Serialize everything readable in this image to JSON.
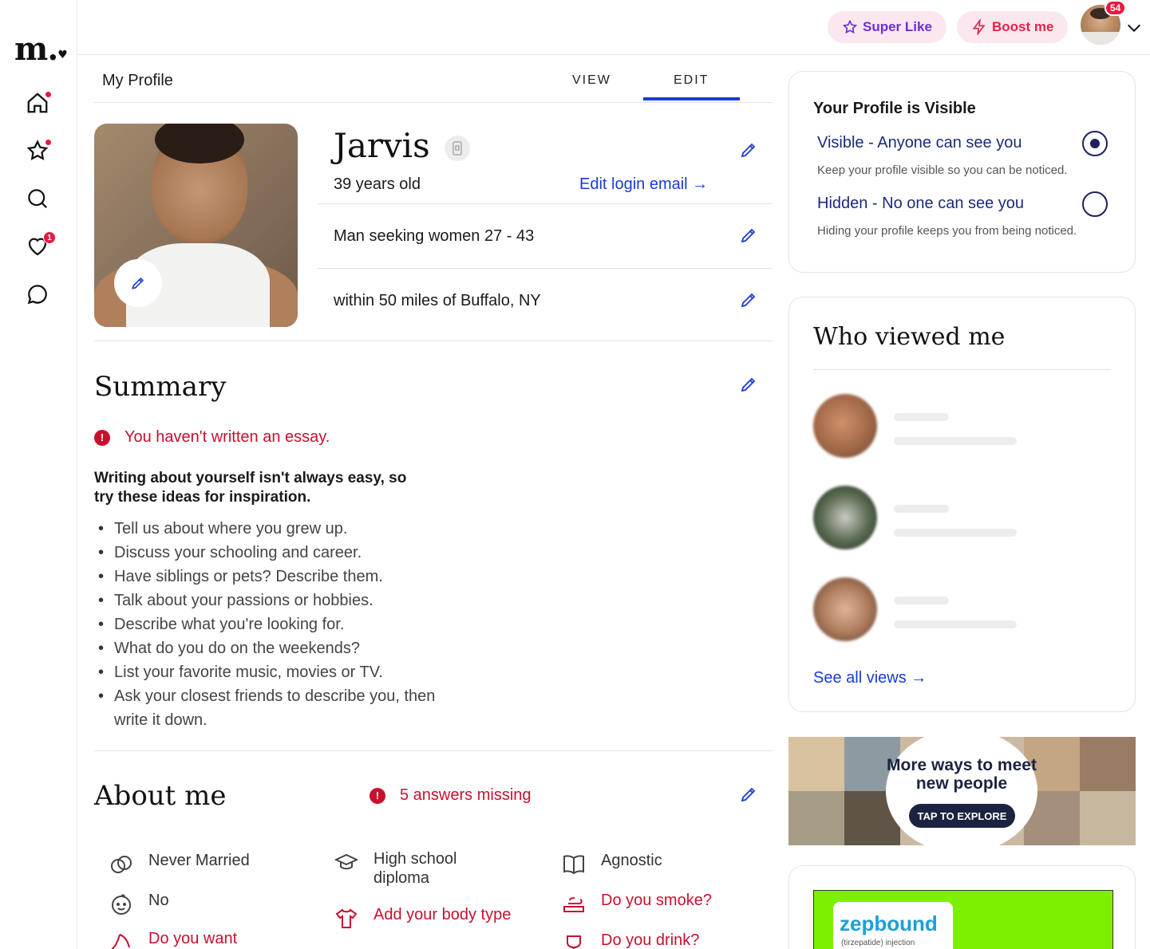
{
  "app": {
    "logo": "m.",
    "logo_heart": "♥"
  },
  "leftnav": {
    "items": [
      {
        "name": "home",
        "badge": ""
      },
      {
        "name": "favorites",
        "badge": ""
      },
      {
        "name": "search",
        "badge": ""
      },
      {
        "name": "likes",
        "badge": "1"
      },
      {
        "name": "messages",
        "badge": ""
      }
    ]
  },
  "topbar": {
    "super_like_label": "Super Like",
    "boost_label": "Boost me",
    "avatar_badge": "54"
  },
  "profile_header": {
    "title": "My Profile",
    "tabs": [
      {
        "label": "VIEW",
        "active": false
      },
      {
        "label": "EDIT",
        "active": true
      }
    ]
  },
  "profile": {
    "name": "Jarvis",
    "age": "39 years old",
    "edit_login_email": "Edit login email →",
    "seeking": "Man seeking women 27 - 43",
    "location": "within 50 miles of Buffalo, NY"
  },
  "summary": {
    "title": "Summary",
    "warning": "You haven't written an essay.",
    "hint": "Writing about yourself isn't always easy, so try these ideas for inspiration.",
    "ideas": [
      "Tell us about where you grew up.",
      "Discuss your schooling and career.",
      "Have siblings or pets? Describe them.",
      "Talk about your passions or hobbies.",
      "Describe what you're looking for.",
      "What do you do on the weekends?",
      "List your favorite music, movies or TV.",
      "Ask your closest friends to describe you, then write it down."
    ]
  },
  "about": {
    "title": "About me",
    "missing": "5 answers missing",
    "items": [
      {
        "label": "Never Married",
        "icon": "rings-icon",
        "missing": false
      },
      {
        "label": "High school diploma",
        "icon": "graduation-cap-icon",
        "missing": false
      },
      {
        "label": "Agnostic",
        "icon": "book-icon",
        "missing": false
      },
      {
        "label": "No",
        "icon": "baby-face-icon",
        "missing": false
      },
      {
        "label": "Add your body type",
        "icon": "shirt-icon",
        "missing": true
      },
      {
        "label": "Do you smoke?",
        "icon": "cigarette-icon",
        "missing": true
      },
      {
        "label": "Do you want",
        "icon": "stroller-icon",
        "missing": true
      },
      {
        "label": "Do you drink?",
        "icon": "glass-icon",
        "missing": true
      }
    ]
  },
  "visibility": {
    "title": "Your Profile is Visible",
    "options": [
      {
        "label": "Visible - Anyone can see you",
        "desc": "Keep your profile visible so you can be noticed.",
        "selected": true
      },
      {
        "label": "Hidden - No one can see you",
        "desc": "Hiding your profile keeps you from being noticed.",
        "selected": false
      }
    ]
  },
  "views": {
    "title": "Who viewed me",
    "see_all": "See all views →"
  },
  "banner": {
    "text": "More ways to meet new people",
    "button": "TAP TO EXPLORE"
  },
  "ad": {
    "brand": "zepbound",
    "sub": "(tirzepatide) injection"
  },
  "colors": {
    "accent_blue": "#1a3bd8",
    "alert_red": "#c8102e",
    "super_like_purple": "#6d2fd4",
    "boost_red": "#e0244a",
    "pill_bg": "#fbe7ef"
  }
}
